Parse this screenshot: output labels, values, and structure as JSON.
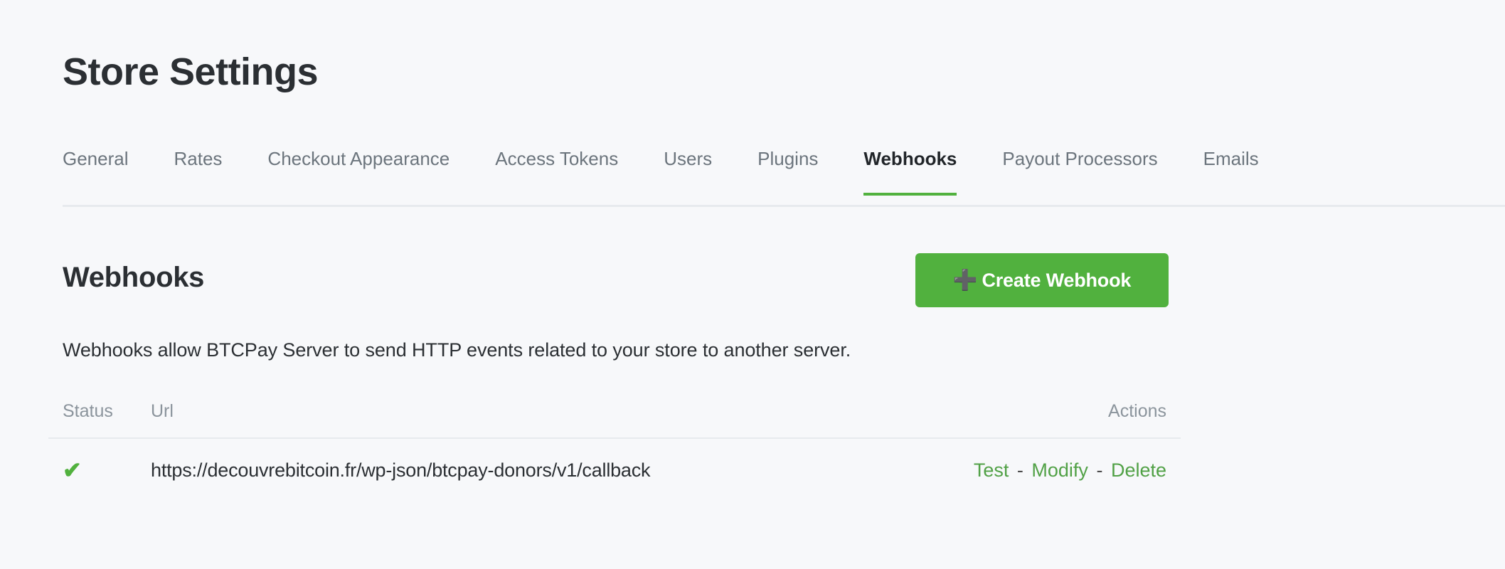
{
  "theme": {
    "background": "#f7f8fa",
    "accent_green": "#51b13e",
    "link_green": "#51a146",
    "text_dark": "#2b2f33",
    "text_muted": "#6c757d",
    "header_muted": "#8b949c",
    "rule": "#e7eaee"
  },
  "header": {
    "title": "Store Settings"
  },
  "tabs": [
    {
      "label": "General",
      "active": false
    },
    {
      "label": "Rates",
      "active": false
    },
    {
      "label": "Checkout Appearance",
      "active": false
    },
    {
      "label": "Access Tokens",
      "active": false
    },
    {
      "label": "Users",
      "active": false
    },
    {
      "label": "Plugins",
      "active": false
    },
    {
      "label": "Webhooks",
      "active": true
    },
    {
      "label": "Payout Processors",
      "active": false
    },
    {
      "label": "Emails",
      "active": false
    }
  ],
  "main": {
    "section_heading": "Webhooks",
    "create_button": {
      "label": "Create Webhook",
      "icon": "plus-icon"
    },
    "description": "Webhooks allow BTCPay Server to send HTTP events related to your store to another server.",
    "table": {
      "columns": [
        "Status",
        "Url",
        "Actions"
      ],
      "rows": [
        {
          "status_icon": "check-icon",
          "status_glyph": "✔",
          "url": "https://decouvrebitcoin.fr/wp-json/btcpay-donors/v1/callback",
          "actions": [
            "Test",
            "Modify",
            "Delete"
          ],
          "action_separator": "-"
        }
      ]
    }
  }
}
